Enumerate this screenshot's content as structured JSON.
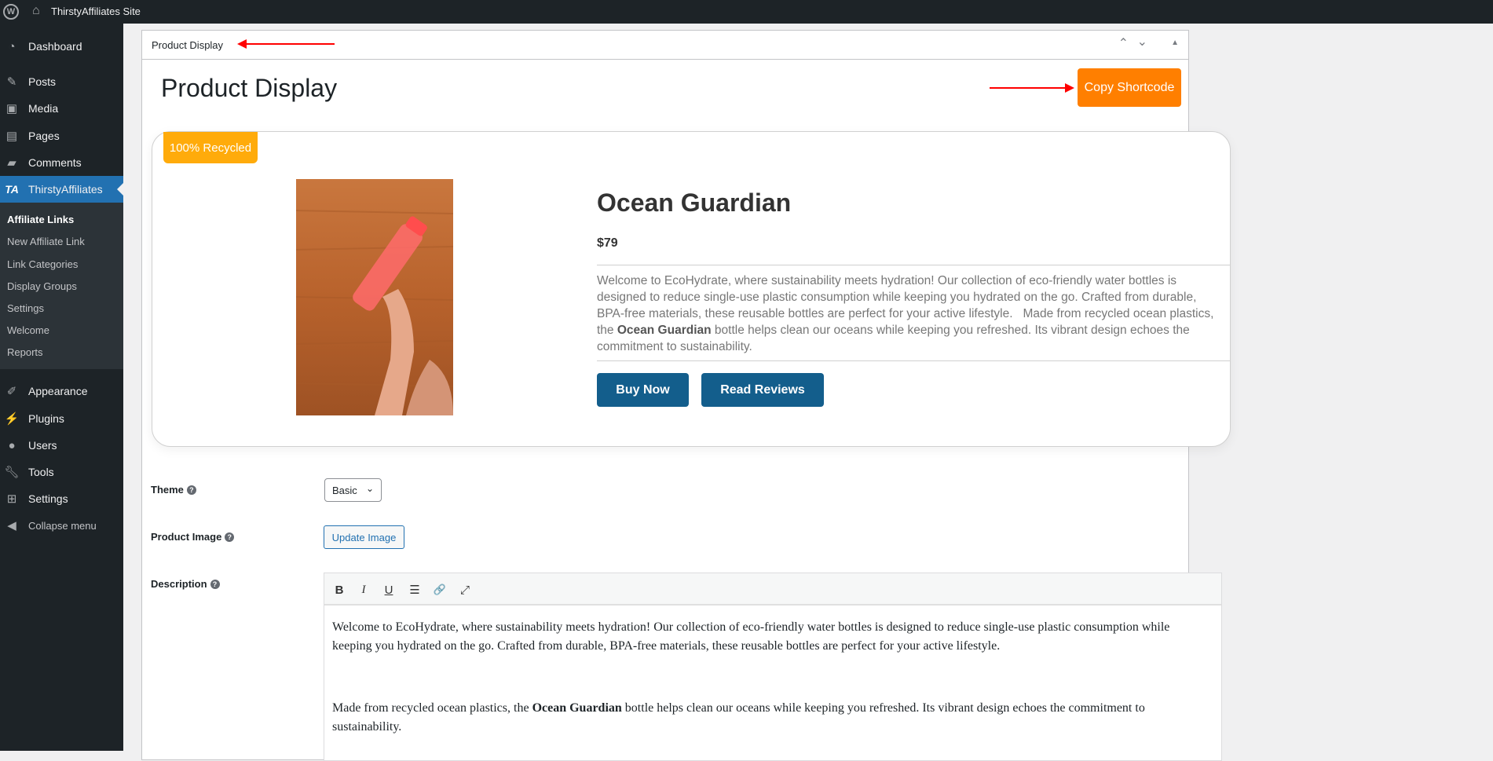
{
  "adminbar": {
    "site_name": "ThirstyAffiliates Site"
  },
  "sidebar": {
    "items": [
      {
        "label": "Dashboard",
        "icon": "dashboard-icon"
      },
      {
        "label": "Posts",
        "icon": "pin-icon"
      },
      {
        "label": "Media",
        "icon": "media-icon"
      },
      {
        "label": "Pages",
        "icon": "pages-icon"
      },
      {
        "label": "Comments",
        "icon": "comments-icon"
      },
      {
        "label": "ThirstyAffiliates",
        "icon": "ta-logo-icon"
      },
      {
        "label": "Appearance",
        "icon": "brush-icon"
      },
      {
        "label": "Plugins",
        "icon": "plugin-icon"
      },
      {
        "label": "Users",
        "icon": "user-icon"
      },
      {
        "label": "Tools",
        "icon": "wrench-icon"
      },
      {
        "label": "Settings",
        "icon": "settings-icon"
      },
      {
        "label": "Collapse menu",
        "icon": "collapse-icon"
      }
    ],
    "ta_logo": "TA",
    "submenu": [
      "Affiliate Links",
      "New Affiliate Link",
      "Link Categories",
      "Display Groups",
      "Settings",
      "Welcome",
      "Reports"
    ]
  },
  "postbox": {
    "title": "Product Display"
  },
  "main": {
    "heading": "Product Display",
    "copy_shortcode": "Copy Shortcode"
  },
  "card": {
    "badge": "100% Recycled",
    "title": "Ocean Guardian",
    "price": "$79",
    "desc_1": "Welcome to EcoHydrate, where sustainability meets hydration! Our collection of eco-friendly water bottles is designed to reduce single-use plastic consumption while keeping you hydrated on the go. Crafted from durable, BPA-free materials, these reusable bottles are perfect for your active lifestyle.   Made from recycled ocean plastics, the ",
    "desc_bold": "Ocean Guardian",
    "desc_2": " bottle helps clean our oceans while keeping you refreshed. Its vibrant design echoes the commitment to sustainability.",
    "buy_now": "Buy Now",
    "read_reviews": "Read Reviews",
    "accent": "#135e8c",
    "badge_color": "#ffab0b"
  },
  "form": {
    "theme_label": "Theme",
    "theme_value": "Basic",
    "image_label": "Product Image",
    "update_image": "Update Image",
    "description_label": "Description",
    "editor": {
      "p1": "Welcome to EcoHydrate, where sustainability meets hydration! Our collection of eco-friendly water bottles is designed to reduce single-use plastic consumption while keeping you hydrated on the go. Crafted from durable, BPA-free materials, these reusable bottles are perfect for your active lifestyle.",
      "p2_a": "Made from recycled ocean plastics, the ",
      "p2_bold": "Ocean Guardian",
      "p2_b": " bottle helps clean our oceans while keeping you refreshed. Its vibrant design echoes the commitment to sustainability.",
      "toolbar": [
        "B",
        "I",
        "U",
        "☰",
        "🔗",
        "⤢"
      ]
    }
  },
  "copy_color": "#ff7f00"
}
